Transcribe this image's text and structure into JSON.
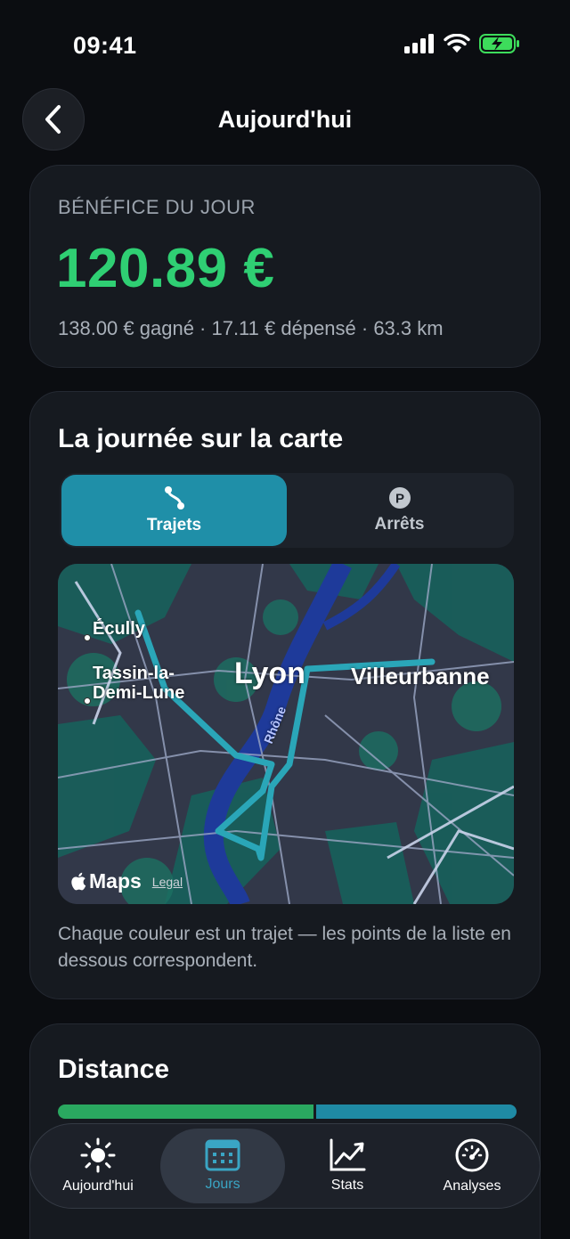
{
  "status": {
    "time": "09:41"
  },
  "header": {
    "title": "Aujourd'hui"
  },
  "profit": {
    "label": "BÉNÉFICE DU JOUR",
    "value": "120.89 €",
    "summary": "138.00 € gagné · 17.11 € dépensé · 63.3 km"
  },
  "map_section": {
    "title": "La journée sur la carte",
    "tabs": [
      {
        "label": "Trajets",
        "icon": "route-icon",
        "active": true
      },
      {
        "label": "Arrêts",
        "icon": "parking-icon",
        "active": false
      }
    ],
    "places": {
      "ecully": "Écully",
      "tassin": "Tassin-la-\nDemi-Lune",
      "lyon": "Lyon",
      "villeurbanne": "Villeurbanne",
      "river": "Rhône"
    },
    "attribution": {
      "brand": "Maps",
      "legal": "Legal"
    },
    "caption": "Chaque couleur est un trajet — les points de la liste en dessous correspondent."
  },
  "distance": {
    "title": "Distance",
    "segments": [
      {
        "share": 0.56,
        "color": "#2aa860"
      },
      {
        "share": 0.44,
        "color": "#1f8aa4"
      }
    ]
  },
  "tabbar": {
    "items": [
      {
        "label": "Aujourd'hui",
        "icon": "sun-icon",
        "active": false
      },
      {
        "label": "Jours",
        "icon": "calendar-icon",
        "active": true
      },
      {
        "label": "Stats",
        "icon": "chart-icon",
        "active": false
      },
      {
        "label": "Analyses",
        "icon": "gauge-icon",
        "active": false
      }
    ]
  },
  "colors": {
    "accent": "#1f8fa8",
    "profit": "#2fcf73",
    "route": "#2aa6b8"
  }
}
